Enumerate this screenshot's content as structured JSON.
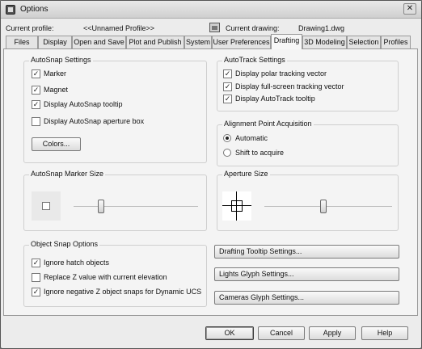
{
  "window": {
    "title": "Options",
    "close_glyph": "✕"
  },
  "profile": {
    "current_profile_label": "Current profile:",
    "current_profile_value": "<<Unnamed Profile>>",
    "current_drawing_label": "Current drawing:",
    "current_drawing_value": "Drawing1.dwg"
  },
  "tabs": [
    "Files",
    "Display",
    "Open and Save",
    "Plot and Publish",
    "System",
    "User Preferences",
    "Drafting",
    "3D Modeling",
    "Selection",
    "Profiles"
  ],
  "active_tab": "Drafting",
  "autosnap": {
    "title": "AutoSnap Settings",
    "marker": {
      "label": "Marker",
      "checked": true
    },
    "magnet": {
      "label": "Magnet",
      "checked": true
    },
    "tooltip": {
      "label": "Display AutoSnap tooltip",
      "checked": true
    },
    "aperture_box": {
      "label": "Display AutoSnap aperture box",
      "checked": false
    },
    "colors_button": "Colors..."
  },
  "autotrack": {
    "title": "AutoTrack Settings",
    "polar": {
      "label": "Display polar tracking vector",
      "checked": true
    },
    "fullscreen": {
      "label": "Display full-screen tracking vector",
      "checked": true
    },
    "tooltip": {
      "label": "Display AutoTrack tooltip",
      "checked": true
    }
  },
  "alignment": {
    "title": "Alignment Point Acquisition",
    "automatic": {
      "label": "Automatic",
      "selected": true
    },
    "shift": {
      "label": "Shift to acquire",
      "selected": false
    }
  },
  "marker_size": {
    "title": "AutoSnap Marker Size"
  },
  "aperture_size": {
    "title": "Aperture Size"
  },
  "object_snap": {
    "title": "Object Snap Options",
    "ignore_hatch": {
      "label": "Ignore hatch objects",
      "checked": true
    },
    "replace_z": {
      "label": "Replace Z value with current elevation",
      "checked": false
    },
    "ignore_negative_z": {
      "label": "Ignore negative Z object snaps for Dynamic UCS",
      "checked": true
    }
  },
  "settings_buttons": {
    "drafting_tooltip": "Drafting Tooltip Settings...",
    "lights_glyph": "Lights Glyph Settings...",
    "cameras_glyph": "Cameras Glyph Settings..."
  },
  "dialog_buttons": {
    "ok": "OK",
    "cancel": "Cancel",
    "apply": "Apply",
    "help": "Help"
  },
  "check_glyph": "✓"
}
